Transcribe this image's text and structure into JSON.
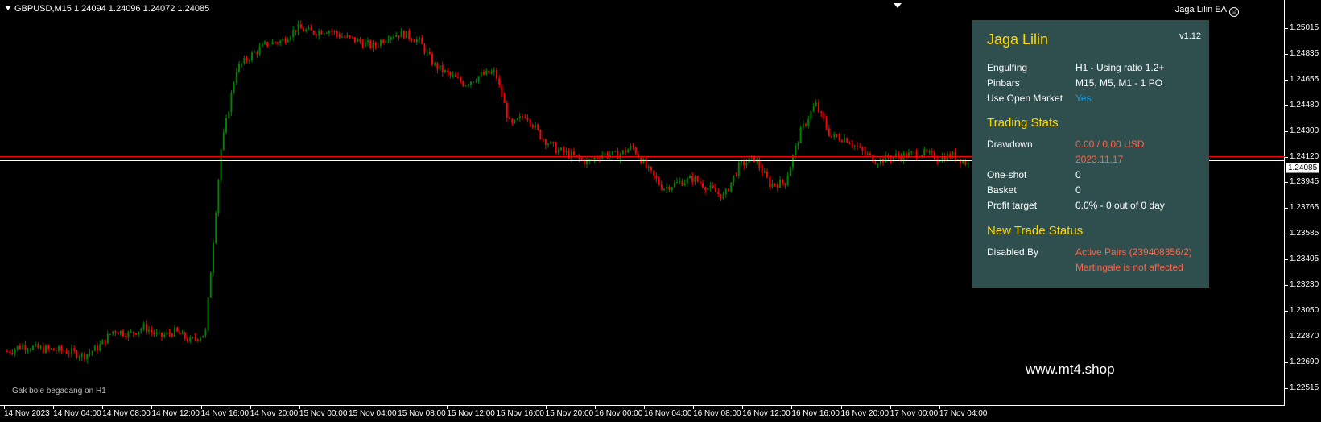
{
  "chart": {
    "symbol_info": "GBPUSD,M15  1.24094 1.24096 1.24072 1.24085",
    "ea_label": "Jaga Lilin EA",
    "current_price": "1.24085",
    "price_ticks": [
      "1.25015",
      "1.24835",
      "1.24655",
      "1.24480",
      "1.24300",
      "1.24120",
      "1.23945",
      "1.23765",
      "1.23585",
      "1.23405",
      "1.23230",
      "1.23050",
      "1.22870",
      "1.22690",
      "1.22515"
    ],
    "time_ticks": [
      "14 Nov 2023",
      "14 Nov 04:00",
      "14 Nov 08:00",
      "14 Nov 12:00",
      "14 Nov 16:00",
      "14 Nov 20:00",
      "15 Nov 00:00",
      "15 Nov 04:00",
      "15 Nov 08:00",
      "15 Nov 12:00",
      "15 Nov 16:00",
      "15 Nov 20:00",
      "16 Nov 00:00",
      "16 Nov 04:00",
      "16 Nov 08:00",
      "16 Nov 12:00",
      "16 Nov 16:00",
      "16 Nov 20:00",
      "17 Nov 00:00",
      "17 Nov 04:00"
    ],
    "footer_note": "Gak bole begadang on H1",
    "watermark": "www.mt4.shop",
    "colors": {
      "bull": "#008000",
      "bear": "#ff0000",
      "ask_line": "#ff0000",
      "bid_line": "#ffffff"
    },
    "price_path": [
      1.2275,
      1.2279,
      1.2277,
      1.2276,
      1.2275,
      1.2272,
      1.2278,
      1.229,
      1.2287,
      1.2292,
      1.2285,
      1.2289,
      1.2282,
      1.2288,
      1.2415,
      1.2472,
      1.2482,
      1.249,
      1.2492,
      1.2501,
      1.2498,
      1.25,
      1.2495,
      1.2492,
      1.2488,
      1.2496,
      1.2497,
      1.2492,
      1.2475,
      1.2468,
      1.2462,
      1.2468,
      1.247,
      1.2432,
      1.2441,
      1.2425,
      1.2416,
      1.2412,
      1.2407,
      1.2413,
      1.2412,
      1.2418,
      1.2402,
      1.2389,
      1.2393,
      1.2396,
      1.2389,
      1.2383,
      1.2405,
      1.241,
      1.2392,
      1.2393,
      1.2428,
      1.2448,
      1.2425,
      1.2424,
      1.2415,
      1.2408,
      1.2411,
      1.2412,
      1.2414,
      1.241,
      1.2412,
      1.2406
    ]
  },
  "panel": {
    "title": "Jaga Lilin",
    "version": "v1.12",
    "settings": [
      {
        "label": "Engulfing",
        "value": "H1 - Using ratio 1.2+",
        "color": "#ffffff"
      },
      {
        "label": "Pinbars",
        "value": "M15, M5, M1 - 1 PO",
        "color": "#ffffff"
      },
      {
        "label": "Use Open Market",
        "value": "Yes",
        "color": "#1e9bd7"
      }
    ],
    "stats_title": "Trading Stats",
    "drawdown_label": "Drawdown",
    "drawdown_value": "0.00 / 0.00 USD",
    "drawdown_date": "2023.11.17",
    "oneshot_label": "One-shot",
    "oneshot_value": "0",
    "basket_label": "Basket",
    "basket_value": "0",
    "profit_label": "Profit target",
    "profit_value": "0.0% - 0 out of 0 day",
    "status_title": "New Trade Status",
    "disabled_label": "Disabled By",
    "disabled_value1": "Active Pairs (239408356/2)",
    "disabled_value2": "Martingale is not affected",
    "accent_red": "#ff6347"
  }
}
